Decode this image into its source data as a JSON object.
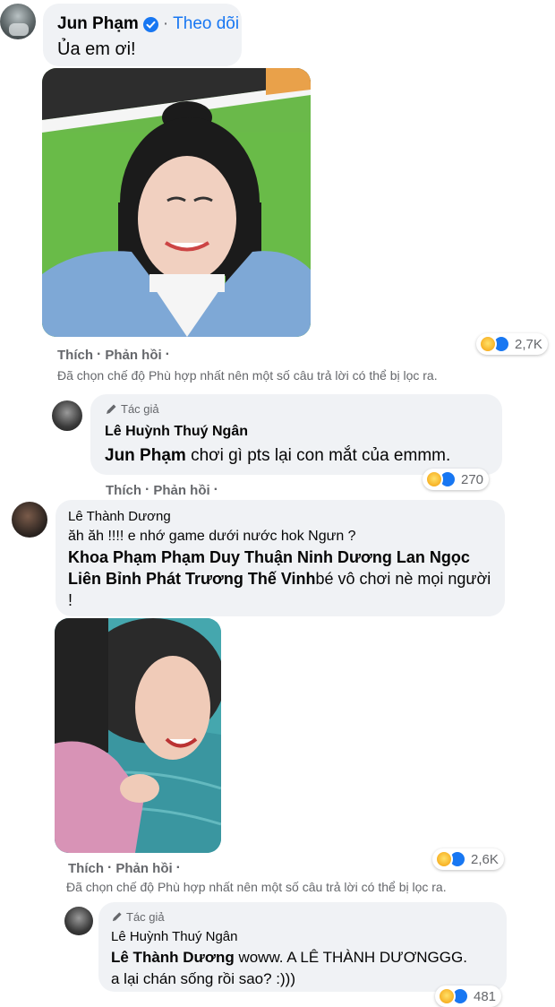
{
  "comment1": {
    "author": "Jun Phạm",
    "follow": "Theo dõi",
    "text": "Ủa em ơi!",
    "like": "Thích",
    "reply": "Phản hồi",
    "reaction_count": "2,7K",
    "filter_note": "Đã chọn chế độ Phù hợp nhất nên một số câu trả lời có thể bị lọc ra."
  },
  "reply1": {
    "badge": "Tác giả",
    "author": "Lê Huỳnh Thuý Ngân",
    "mention": "Jun Phạm",
    "text": " chơi gì pts lại con mắt của emmm.",
    "like": "Thích",
    "reply": "Phản hồi",
    "reaction_count": "270"
  },
  "comment2": {
    "author": "Lê Thành Dương",
    "line1": "ăh ăh !!!! e nhớ game dưới nước hok Ngưn ?",
    "mentions_line2": "Khoa Phạm Phạm Duy Thuận Ninh Dương Lan Ngọc",
    "mentions_line3": "Liên Bỉnh Phát Trương Thế Vinh",
    "text_line3": "bé vô chơi nè mọi người",
    "text_line4": "!",
    "like": "Thích",
    "reply": "Phản hồi",
    "reaction_count": "2,6K",
    "filter_note": "Đã chọn chế độ Phù hợp nhất nên một số câu trả lời có thể bị lọc ra."
  },
  "reply2": {
    "badge": "Tác giả",
    "author": "Lê Huỳnh Thuý Ngân",
    "mention": "Lê Thành Dương",
    "text_line1": " woww. A LÊ THÀNH DƯƠNGGG.",
    "text_line2": "a lại chán sống rồi sao? :)))",
    "reaction_count": "481"
  },
  "colors": {
    "verified": "#1877f2",
    "follow": "#1877f2",
    "bubble": "#f0f2f5",
    "meta": "#65676b"
  }
}
